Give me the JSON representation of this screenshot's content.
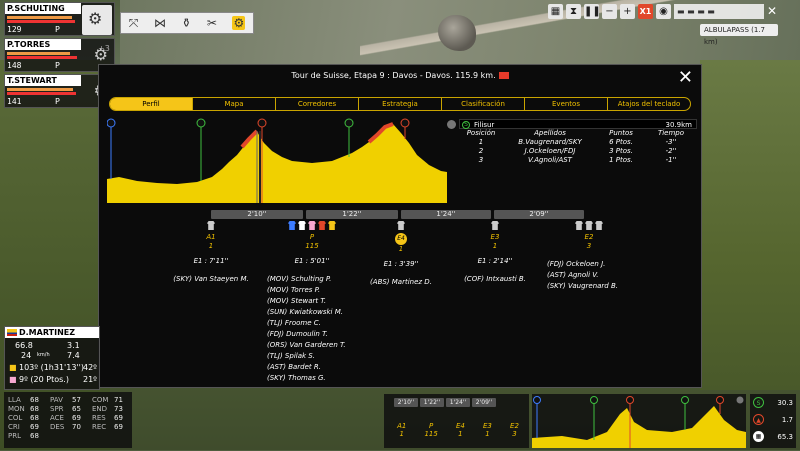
{
  "riders": [
    {
      "name": "P.SCHULTING",
      "energy": "129",
      "mode": "P"
    },
    {
      "name": "P.TORRES",
      "energy": "148",
      "mode": "P"
    },
    {
      "name": "T.STEWART",
      "energy": "141",
      "mode": "P"
    }
  ],
  "side_value": "+3",
  "hud": {
    "speed_label": "X1",
    "climb": "ALBULAPASS (1.7 km)"
  },
  "modal": {
    "title": "Tour de Suisse, Etapa 9 : Davos - Davos. 115.9 km.",
    "tabs": [
      "Perfil",
      "Mapa",
      "Corredores",
      "Estrategia",
      "Clasificación",
      "Eventos",
      "Atajos del teclado"
    ],
    "leader_name": "Filisur",
    "leader_km": "30.9km",
    "table_headers": [
      "Posición",
      "Apellidos",
      "Puntos",
      "Tiempo"
    ],
    "table_rows": [
      [
        "1",
        "B.Vaugrenard/SKY",
        "6 Ptos.",
        "-3''"
      ],
      [
        "2",
        "J.Ockeloen/FDJ",
        "3 Ptos.",
        "-2''"
      ],
      [
        "3",
        "V.Agnoli/AST",
        "1 Ptos.",
        "-1''"
      ]
    ],
    "gaps": [
      "2'10''",
      "1'22''",
      "1'24''",
      "2'09''"
    ],
    "groups": [
      {
        "name": "A1",
        "count": "1",
        "time": "E1 : 7'11''",
        "riders": [
          "(SKY) Van Staeyen M."
        ]
      },
      {
        "name": "P",
        "count": "115",
        "time": "E1 : 5'01''",
        "riders": [
          "(MOV) Schulting P.",
          "(MOV) Torres P.",
          "(MOV) Stewart T.",
          "(SUN) Kwiatkowski M.",
          "(TLJ) Froome C.",
          "(FDJ) Dumoulin T.",
          "(ORS) Van Garderen T.",
          "(TLJ) Spilak S.",
          "(AST) Bardet R.",
          "(SKY) Thomas G."
        ]
      },
      {
        "name": "E4",
        "count": "1",
        "time": "E1 : 3'39''",
        "riders": [
          "(ABS) Martinez D."
        ]
      },
      {
        "name": "E3",
        "count": "1",
        "time": "E1 : 2'14''",
        "riders": [
          "(COF) Intxausti B."
        ]
      },
      {
        "name": "E2",
        "count": "3",
        "time": "",
        "riders": [
          "(FDJ) Ockeloen J.",
          "(AST) Agnoli V.",
          "(SKY) Vaugrenard B."
        ]
      }
    ]
  },
  "detail": {
    "name": "D.MARTINEZ",
    "speed": "66.8",
    "kmh": "24",
    "kmh_unit": "km/h",
    "grade": "3.1",
    "power": "7.4",
    "rank_time": "103º (1h31'13'')",
    "rank_pts": "9º (20 Ptos.)",
    "rank2": "42º",
    "rank3": "21º"
  },
  "stats": [
    [
      "LLA",
      "68",
      "PAV",
      "57",
      "COM",
      "71"
    ],
    [
      "MON",
      "68",
      "SPR",
      "65",
      "END",
      "73"
    ],
    [
      "COL",
      "68",
      "ACE",
      "69",
      "RES",
      "69"
    ],
    [
      "CRI",
      "69",
      "DES",
      "70",
      "REC",
      "69"
    ],
    [
      "PRL",
      "68",
      "",
      "",
      "",
      ""
    ]
  ],
  "mini": {
    "gaps": [
      "2'10''",
      "1'22''",
      "1'24''",
      "2'09''"
    ],
    "groups": [
      [
        "A1",
        "1"
      ],
      [
        "P",
        "115"
      ],
      [
        "E4",
        "1"
      ],
      [
        "E3",
        "1"
      ],
      [
        "E2",
        "3"
      ]
    ],
    "values": [
      "30.3",
      "1.7",
      "65.3"
    ]
  },
  "colors": {
    "accent": "#f5c518",
    "profile": "#f0d000",
    "climb": "#e1472a"
  }
}
